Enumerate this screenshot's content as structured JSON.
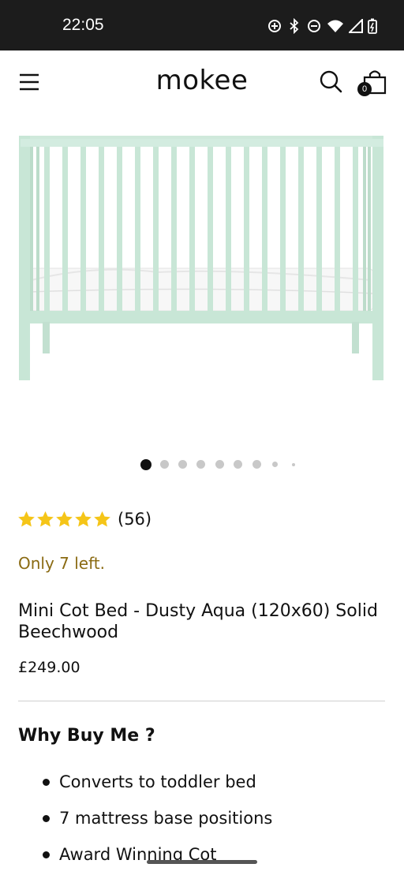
{
  "status_bar": {
    "time": "22:05",
    "icons": [
      "data-saver-icon",
      "bluetooth-icon",
      "do-not-disturb-icon",
      "wifi-icon",
      "cellular-signal-icon",
      "battery-charging-icon"
    ]
  },
  "header": {
    "logo": "mokee",
    "cart_count": "0",
    "icons": [
      "menu-icon",
      "search-icon",
      "shopping-bag-icon"
    ]
  },
  "gallery": {
    "image_subject": "Mini cot bed in dusty aqua with white mattress",
    "slide_count": 9,
    "active_slide": 1
  },
  "product": {
    "rating_stars": 5,
    "review_count": "(56)",
    "stock_note": "Only 7 left.",
    "title": "Mini Cot Bed - Dusty Aqua (120x60) Solid Beechwood",
    "price": "£249.00"
  },
  "why_buy": {
    "heading": "Why Buy Me ?",
    "items": [
      "Converts to toddler bed",
      "7 mattress base positions",
      "Award Winning Cot"
    ]
  },
  "colors": {
    "status_bar_bg": "#1c1c1c",
    "stock_text": "#8a6a12",
    "star": "#f5c518",
    "crib": "#c8e6d6",
    "active_dot": "#111111"
  }
}
